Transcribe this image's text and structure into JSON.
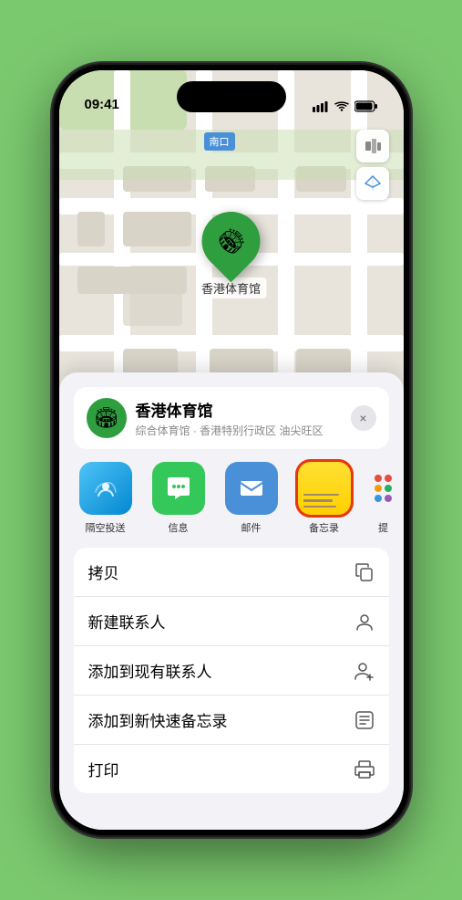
{
  "status": {
    "time": "09:41",
    "location_arrow": "▲"
  },
  "map": {
    "label": "南口",
    "pin_label": "香港体育馆"
  },
  "controls": {
    "map_type": "🗺",
    "location": "➤"
  },
  "place_card": {
    "name": "香港体育馆",
    "subtitle": "综合体育馆 · 香港特别行政区 油尖旺区",
    "close_label": "×"
  },
  "share_items": [
    {
      "id": "airdrop",
      "label": "隔空投送"
    },
    {
      "id": "messages",
      "label": "信息"
    },
    {
      "id": "mail",
      "label": "邮件"
    },
    {
      "id": "notes",
      "label": "备忘录"
    },
    {
      "id": "more",
      "label": "提"
    }
  ],
  "actions": [
    {
      "label": "拷贝",
      "icon": "copy"
    },
    {
      "label": "新建联系人",
      "icon": "person"
    },
    {
      "label": "添加到现有联系人",
      "icon": "person-add"
    },
    {
      "label": "添加到新快速备忘录",
      "icon": "note"
    },
    {
      "label": "打印",
      "icon": "print"
    }
  ]
}
